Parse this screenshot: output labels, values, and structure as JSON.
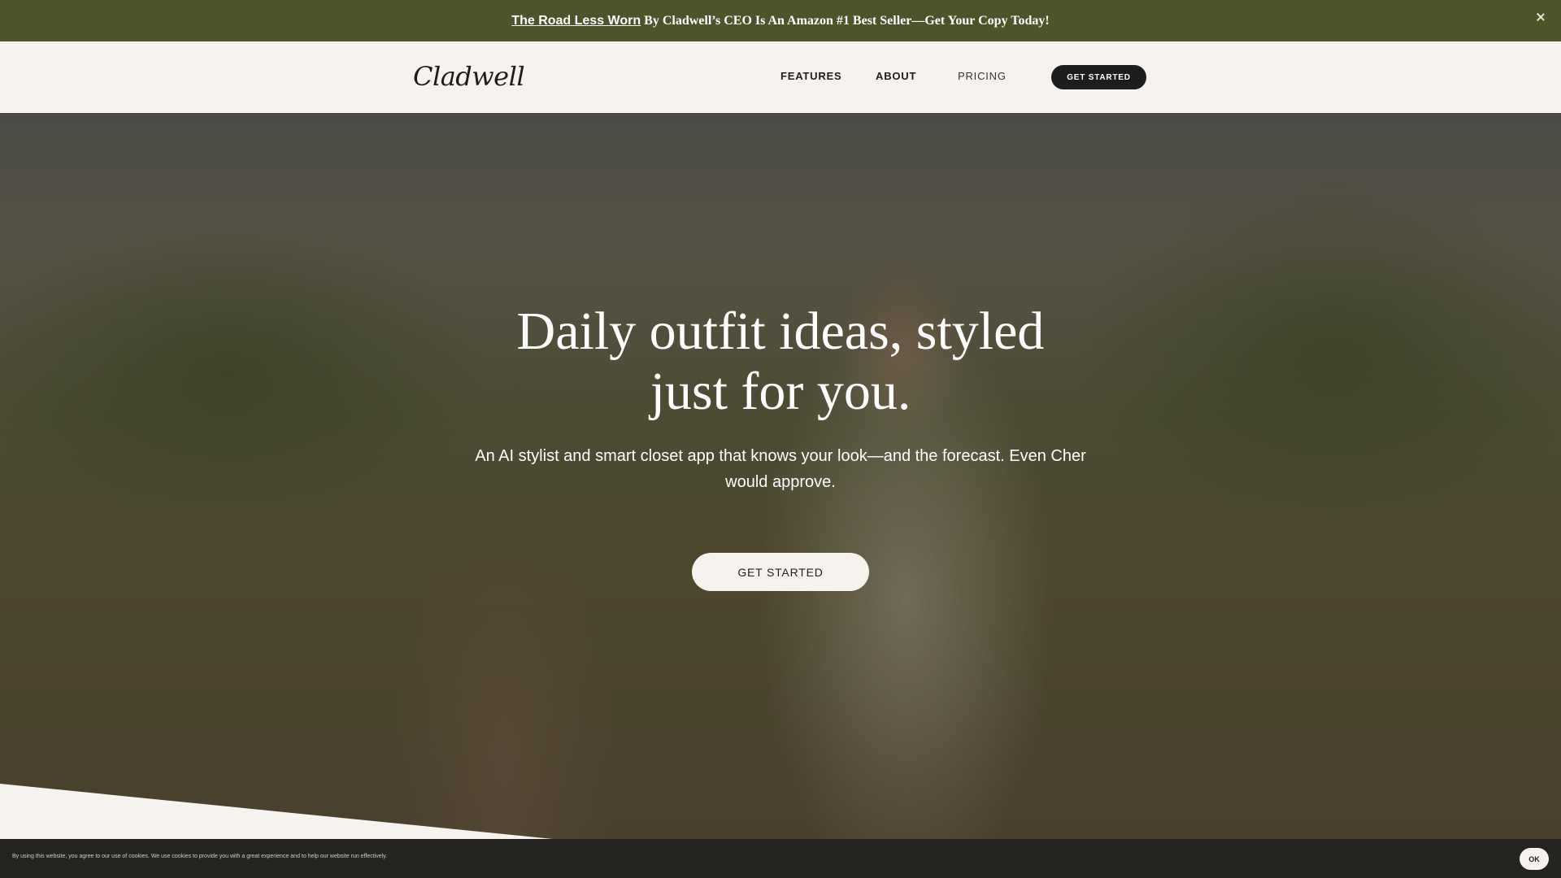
{
  "announcement": {
    "link_text": "The Road Less Worn",
    "text": "By Cladwell’s CEO Is An Amazon #1 Best Seller—Get Your Copy Today!"
  },
  "header": {
    "logo": "Cladwell",
    "nav": [
      "FEATURES",
      "ABOUT",
      "PRICING"
    ],
    "cta": "GET STARTED"
  },
  "hero": {
    "title_line1": "Daily outfit ideas, styled",
    "title_line2": "just for you.",
    "subtitle": "An AI stylist and smart closet app that knows your look—and the forecast. Even Cher would approve.",
    "cta": "GET STARTED"
  },
  "cookie": {
    "text": "By using this website, you agree to our use of cookies. We use cookies to provide you with a great experience and to help our website run effectively.",
    "ok": "OK"
  },
  "colors": {
    "announcement_bg": "#4e5429",
    "header_bg": "#f6f2ed",
    "cta_dark": "#1d1d1d",
    "cookie_bg": "#252420"
  },
  "icons": [
    "close-icon"
  ]
}
